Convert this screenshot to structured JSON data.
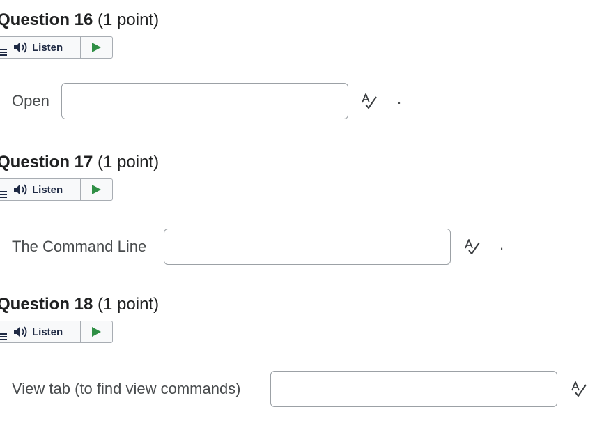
{
  "questions": [
    {
      "title": "Question 16",
      "points": "(1 point)",
      "listen_label": "Listen",
      "prompt": "Open",
      "answer_value": "",
      "trailing": "."
    },
    {
      "title": "Question 17",
      "points": "(1 point)",
      "listen_label": "Listen",
      "prompt": "The Command Line",
      "answer_value": "",
      "trailing": "."
    },
    {
      "title": "Question 18",
      "points": "(1 point)",
      "listen_label": "Listen",
      "prompt": "View tab (to find view commands)",
      "answer_value": "",
      "trailing": ""
    }
  ],
  "icons": {
    "menu": "menu-icon",
    "speaker": "speaker-icon",
    "play": "play-icon",
    "spellcheck": "spellcheck-icon"
  },
  "colors": {
    "play_green": "#2f8f45",
    "title_text": "#202122",
    "body_text": "#494c4e",
    "border": "#9ca1a6"
  }
}
